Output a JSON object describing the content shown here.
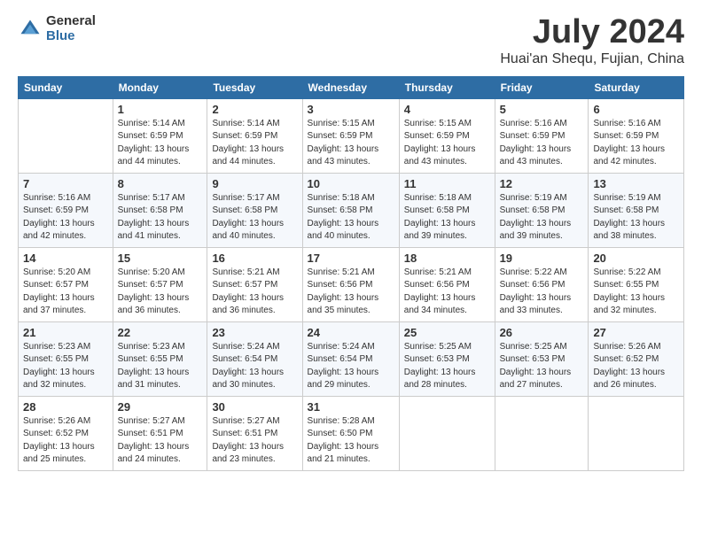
{
  "header": {
    "logo_general": "General",
    "logo_blue": "Blue",
    "title": "July 2024",
    "location": "Huai'an Shequ, Fujian, China"
  },
  "days_of_week": [
    "Sunday",
    "Monday",
    "Tuesday",
    "Wednesday",
    "Thursday",
    "Friday",
    "Saturday"
  ],
  "weeks": [
    [
      {
        "day": "",
        "info": ""
      },
      {
        "day": "1",
        "info": "Sunrise: 5:14 AM\nSunset: 6:59 PM\nDaylight: 13 hours\nand 44 minutes."
      },
      {
        "day": "2",
        "info": "Sunrise: 5:14 AM\nSunset: 6:59 PM\nDaylight: 13 hours\nand 44 minutes."
      },
      {
        "day": "3",
        "info": "Sunrise: 5:15 AM\nSunset: 6:59 PM\nDaylight: 13 hours\nand 43 minutes."
      },
      {
        "day": "4",
        "info": "Sunrise: 5:15 AM\nSunset: 6:59 PM\nDaylight: 13 hours\nand 43 minutes."
      },
      {
        "day": "5",
        "info": "Sunrise: 5:16 AM\nSunset: 6:59 PM\nDaylight: 13 hours\nand 43 minutes."
      },
      {
        "day": "6",
        "info": "Sunrise: 5:16 AM\nSunset: 6:59 PM\nDaylight: 13 hours\nand 42 minutes."
      }
    ],
    [
      {
        "day": "7",
        "info": "Sunrise: 5:16 AM\nSunset: 6:59 PM\nDaylight: 13 hours\nand 42 minutes."
      },
      {
        "day": "8",
        "info": "Sunrise: 5:17 AM\nSunset: 6:58 PM\nDaylight: 13 hours\nand 41 minutes."
      },
      {
        "day": "9",
        "info": "Sunrise: 5:17 AM\nSunset: 6:58 PM\nDaylight: 13 hours\nand 40 minutes."
      },
      {
        "day": "10",
        "info": "Sunrise: 5:18 AM\nSunset: 6:58 PM\nDaylight: 13 hours\nand 40 minutes."
      },
      {
        "day": "11",
        "info": "Sunrise: 5:18 AM\nSunset: 6:58 PM\nDaylight: 13 hours\nand 39 minutes."
      },
      {
        "day": "12",
        "info": "Sunrise: 5:19 AM\nSunset: 6:58 PM\nDaylight: 13 hours\nand 39 minutes."
      },
      {
        "day": "13",
        "info": "Sunrise: 5:19 AM\nSunset: 6:58 PM\nDaylight: 13 hours\nand 38 minutes."
      }
    ],
    [
      {
        "day": "14",
        "info": "Sunrise: 5:20 AM\nSunset: 6:57 PM\nDaylight: 13 hours\nand 37 minutes."
      },
      {
        "day": "15",
        "info": "Sunrise: 5:20 AM\nSunset: 6:57 PM\nDaylight: 13 hours\nand 36 minutes."
      },
      {
        "day": "16",
        "info": "Sunrise: 5:21 AM\nSunset: 6:57 PM\nDaylight: 13 hours\nand 36 minutes."
      },
      {
        "day": "17",
        "info": "Sunrise: 5:21 AM\nSunset: 6:56 PM\nDaylight: 13 hours\nand 35 minutes."
      },
      {
        "day": "18",
        "info": "Sunrise: 5:21 AM\nSunset: 6:56 PM\nDaylight: 13 hours\nand 34 minutes."
      },
      {
        "day": "19",
        "info": "Sunrise: 5:22 AM\nSunset: 6:56 PM\nDaylight: 13 hours\nand 33 minutes."
      },
      {
        "day": "20",
        "info": "Sunrise: 5:22 AM\nSunset: 6:55 PM\nDaylight: 13 hours\nand 32 minutes."
      }
    ],
    [
      {
        "day": "21",
        "info": "Sunrise: 5:23 AM\nSunset: 6:55 PM\nDaylight: 13 hours\nand 32 minutes."
      },
      {
        "day": "22",
        "info": "Sunrise: 5:23 AM\nSunset: 6:55 PM\nDaylight: 13 hours\nand 31 minutes."
      },
      {
        "day": "23",
        "info": "Sunrise: 5:24 AM\nSunset: 6:54 PM\nDaylight: 13 hours\nand 30 minutes."
      },
      {
        "day": "24",
        "info": "Sunrise: 5:24 AM\nSunset: 6:54 PM\nDaylight: 13 hours\nand 29 minutes."
      },
      {
        "day": "25",
        "info": "Sunrise: 5:25 AM\nSunset: 6:53 PM\nDaylight: 13 hours\nand 28 minutes."
      },
      {
        "day": "26",
        "info": "Sunrise: 5:25 AM\nSunset: 6:53 PM\nDaylight: 13 hours\nand 27 minutes."
      },
      {
        "day": "27",
        "info": "Sunrise: 5:26 AM\nSunset: 6:52 PM\nDaylight: 13 hours\nand 26 minutes."
      }
    ],
    [
      {
        "day": "28",
        "info": "Sunrise: 5:26 AM\nSunset: 6:52 PM\nDaylight: 13 hours\nand 25 minutes."
      },
      {
        "day": "29",
        "info": "Sunrise: 5:27 AM\nSunset: 6:51 PM\nDaylight: 13 hours\nand 24 minutes."
      },
      {
        "day": "30",
        "info": "Sunrise: 5:27 AM\nSunset: 6:51 PM\nDaylight: 13 hours\nand 23 minutes."
      },
      {
        "day": "31",
        "info": "Sunrise: 5:28 AM\nSunset: 6:50 PM\nDaylight: 13 hours\nand 21 minutes."
      },
      {
        "day": "",
        "info": ""
      },
      {
        "day": "",
        "info": ""
      },
      {
        "day": "",
        "info": ""
      }
    ]
  ]
}
